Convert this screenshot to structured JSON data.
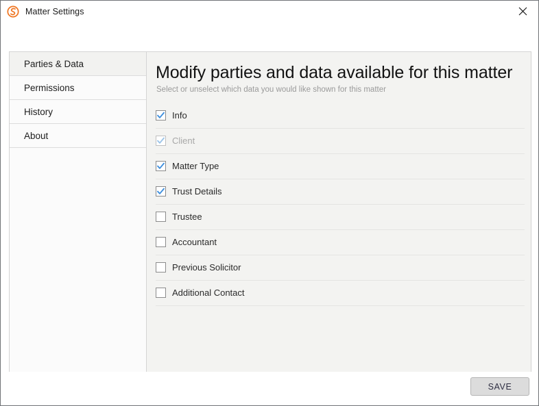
{
  "window": {
    "title": "Matter Settings",
    "app_icon": "spiral-s-logo-icon",
    "app_icon_color": "#ef7622",
    "close_icon": "close-icon"
  },
  "sidebar": {
    "items": [
      {
        "label": "Parties & Data",
        "selected": true
      },
      {
        "label": "Permissions",
        "selected": false
      },
      {
        "label": "History",
        "selected": false
      },
      {
        "label": "About",
        "selected": false
      }
    ]
  },
  "content": {
    "heading": "Modify parties and data available for this matter",
    "subheading": "Select or unselect which data you would like shown for this matter",
    "checkbox_check_color": "#3f8fdd",
    "checkbox_check_color_disabled": "#9cc4e8",
    "rows": [
      {
        "label": "Info",
        "checked": true,
        "disabled": false
      },
      {
        "label": "Client",
        "checked": true,
        "disabled": true
      },
      {
        "label": "Matter Type",
        "checked": true,
        "disabled": false
      },
      {
        "label": "Trust Details",
        "checked": true,
        "disabled": false
      },
      {
        "label": "Trustee",
        "checked": false,
        "disabled": false
      },
      {
        "label": "Accountant",
        "checked": false,
        "disabled": false
      },
      {
        "label": "Previous Solicitor",
        "checked": false,
        "disabled": false
      },
      {
        "label": "Additional Contact",
        "checked": false,
        "disabled": false
      }
    ]
  },
  "footer": {
    "save_label": "SAVE"
  }
}
